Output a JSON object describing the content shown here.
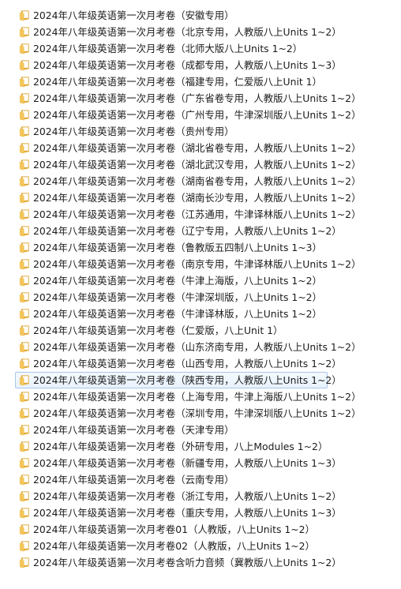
{
  "files": [
    {
      "name": "2024年八年级英语第一次月考卷（安徽专用）",
      "icon": "folder-icon"
    },
    {
      "name": "2024年八年级英语第一次月考卷（北京专用，人教版八上Units 1~2）",
      "icon": "folder-icon"
    },
    {
      "name": "2024年八年级英语第一次月考卷（北师大版八上Units 1~2）",
      "icon": "folder-icon"
    },
    {
      "name": "2024年八年级英语第一次月考卷（成都专用，人教版八上Units 1~3）",
      "icon": "folder-icon"
    },
    {
      "name": "2024年八年级英语第一次月考卷（福建专用，仁爱版八上Unit 1）",
      "icon": "folder-icon"
    },
    {
      "name": "2024年八年级英语第一次月考卷（广东省卷专用，人教版八上Units 1~2）",
      "icon": "folder-icon"
    },
    {
      "name": "2024年八年级英语第一次月考卷（广州专用，牛津深圳版八上Units 1~2）",
      "icon": "folder-icon"
    },
    {
      "name": "2024年八年级英语第一次月考卷（贵州专用）",
      "icon": "folder-icon"
    },
    {
      "name": "2024年八年级英语第一次月考卷（湖北省卷专用，人教版八上Units 1~2）",
      "icon": "folder-icon"
    },
    {
      "name": "2024年八年级英语第一次月考卷（湖北武汉专用，人教版八上Units 1~2）",
      "icon": "folder-icon"
    },
    {
      "name": "2024年八年级英语第一次月考卷（湖南省卷专用，人教版八上Units 1~2）",
      "icon": "folder-icon"
    },
    {
      "name": "2024年八年级英语第一次月考卷（湖南长沙专用，人教版八上Units 1~2）",
      "icon": "folder-icon"
    },
    {
      "name": "2024年八年级英语第一次月考卷（江苏通用，牛津译林版八上Units 1~2）",
      "icon": "folder-icon"
    },
    {
      "name": "2024年八年级英语第一次月考卷（辽宁专用，人教版八上Units 1~2）",
      "icon": "folder-icon"
    },
    {
      "name": "2024年八年级英语第一次月考卷（鲁教版五四制八上Units 1~3）",
      "icon": "folder-icon"
    },
    {
      "name": "2024年八年级英语第一次月考卷（南京专用，牛津译林版八上Units 1~2）",
      "icon": "folder-icon"
    },
    {
      "name": "2024年八年级英语第一次月考卷（牛津上海版，八上Units 1~2）",
      "icon": "folder-icon"
    },
    {
      "name": "2024年八年级英语第一次月考卷（牛津深圳版，八上Units 1~2）",
      "icon": "folder-icon"
    },
    {
      "name": "2024年八年级英语第一次月考卷（牛津译林版，八上Units 1~2）",
      "icon": "folder-icon"
    },
    {
      "name": "2024年八年级英语第一次月考卷（仁爱版，八上Unit 1）",
      "icon": "folder-icon"
    },
    {
      "name": "2024年八年级英语第一次月考卷（山东济南专用，人教版八上Units 1~2）",
      "icon": "folder-icon"
    },
    {
      "name": "2024年八年级英语第一次月考卷（山西专用，人教版八上Units 1~2）",
      "icon": "folder-icon"
    },
    {
      "name": "2024年八年级英语第一次月考卷（陕西专用，人教版八上Units 1~2）",
      "icon": "folder-icon",
      "selected": true
    },
    {
      "name": "2024年八年级英语第一次月考卷（上海专用，牛津上海版八上Units 1~2）",
      "icon": "folder-icon"
    },
    {
      "name": "2024年八年级英语第一次月考卷（深圳专用，牛津深圳版八上Units 1~2）",
      "icon": "folder-icon"
    },
    {
      "name": "2024年八年级英语第一次月考卷（天津专用）",
      "icon": "folder-icon"
    },
    {
      "name": "2024年八年级英语第一次月考卷（外研专用，八上Modules 1~2）",
      "icon": "folder-icon"
    },
    {
      "name": "2024年八年级英语第一次月考卷（新疆专用，人教版八上Units 1~3）",
      "icon": "folder-icon"
    },
    {
      "name": "2024年八年级英语第一次月考卷（云南专用）",
      "icon": "folder-icon"
    },
    {
      "name": "2024年八年级英语第一次月考卷（浙江专用，人教版八上Units 1~2）",
      "icon": "folder-icon"
    },
    {
      "name": "2024年八年级英语第一次月考卷（重庆专用，人教版八上Units 1~3）",
      "icon": "folder-icon"
    },
    {
      "name": "2024年八年级英语第一次月考卷01（人教版，八上Units 1~2）",
      "icon": "folder-icon"
    },
    {
      "name": "2024年八年级英语第一次月考卷02（人教版，八上Units 1~2）",
      "icon": "folder-icon"
    },
    {
      "name": "2024年八年级英语第一次月考卷含听力音频（冀教版八上Units 1~2）",
      "icon": "folder-icon"
    }
  ],
  "colors": {
    "folder_body": "#f3c55a",
    "folder_back": "#e0a93a",
    "folder_paper": "#ffffff",
    "selection_border": "#a9c6e8"
  }
}
